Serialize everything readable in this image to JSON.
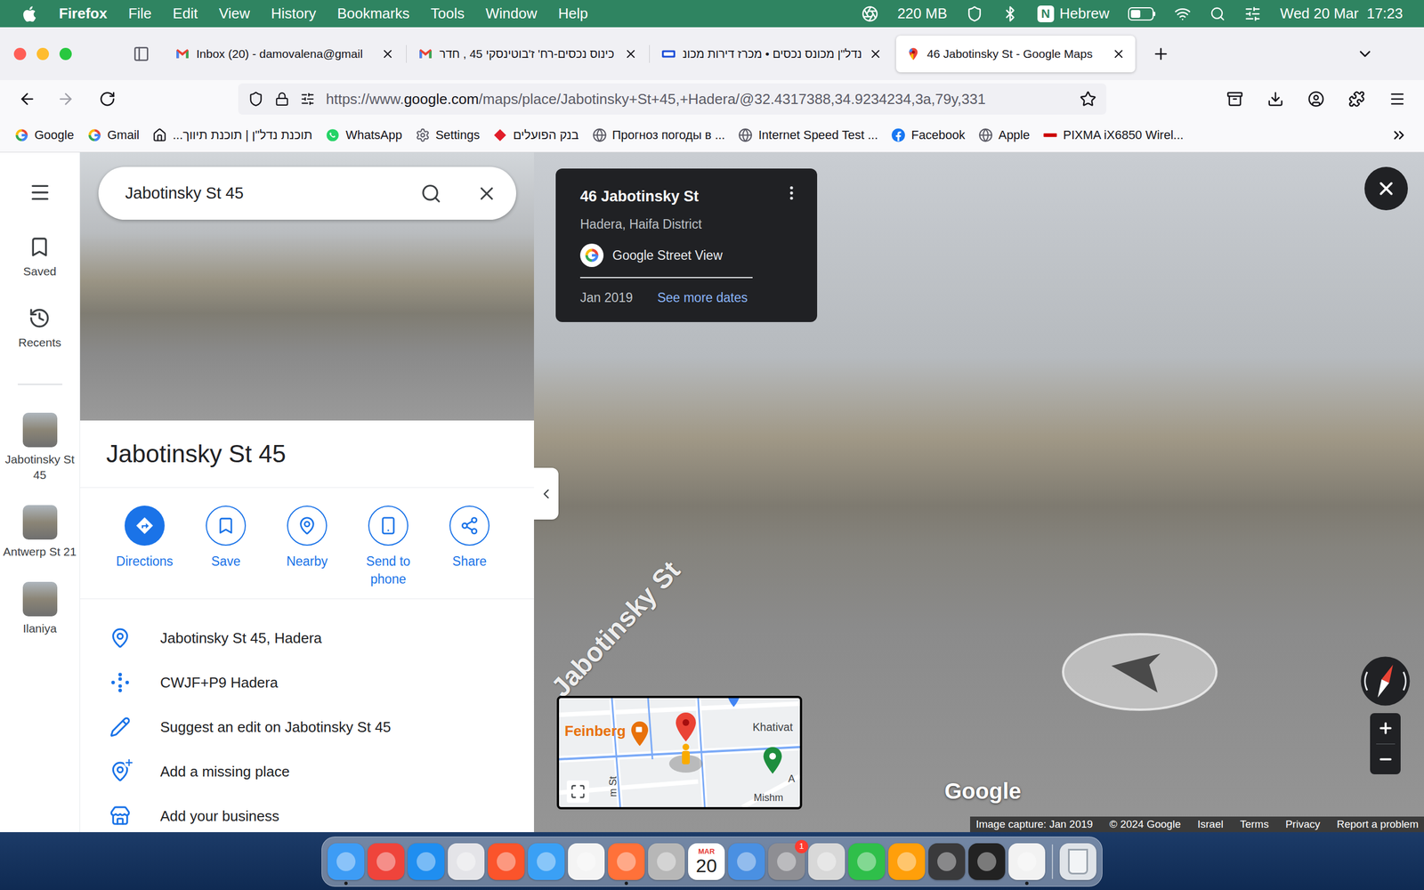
{
  "menu_bar": {
    "app": "Firefox",
    "menus": [
      "File",
      "Edit",
      "View",
      "History",
      "Bookmarks",
      "Tools",
      "Window",
      "Help"
    ],
    "memory": "220 MB",
    "input_source": "N",
    "input_label": "Hebrew",
    "battery": {
      "level": 0.45
    },
    "datetime": "Wed 20 Mar  17:23"
  },
  "tabs": [
    {
      "label": "Inbox (20) - damovalena@gmail",
      "kind": "gmail",
      "selected": false
    },
    {
      "label": "כינוס נכסים-רח' ז'בוטינסקי 45 , חדר",
      "kind": "gmail",
      "selected": false
    },
    {
      "label": "נדל\"ן מכונס נכסים • מכרז דירות מכונ",
      "kind": "site",
      "selected": false
    },
    {
      "label": "46 Jabotinsky St - Google Maps",
      "kind": "maps",
      "selected": true
    }
  ],
  "address_bar": {
    "prefix": "https://www.",
    "domain": "google.com",
    "path": "/maps/place/Jabotinsky+St+45,+Hadera/@32.4317388,34.9234234,3a,79y,331"
  },
  "bookmarks": [
    {
      "label": "Google",
      "kind": "google"
    },
    {
      "label": "Gmail",
      "kind": "google"
    },
    {
      "label": "תוכנת נדל\"ן | תוכנת תיווך...",
      "kind": "house"
    },
    {
      "label": "WhatsApp",
      "kind": "whatsapp"
    },
    {
      "label": "Settings",
      "kind": "gear"
    },
    {
      "label": "בנק הפועלים",
      "kind": "bank"
    },
    {
      "label": "Прогноз погоды в ...",
      "kind": "globe"
    },
    {
      "label": "Internet Speed Test ...",
      "kind": "globe"
    },
    {
      "label": "Facebook",
      "kind": "facebook"
    },
    {
      "label": "Apple",
      "kind": "globe"
    },
    {
      "label": "PIXMA iX6850 Wirel...",
      "kind": "canon"
    }
  ],
  "maps": {
    "search": {
      "value": "Jabotinsky St 45"
    },
    "rail": {
      "saved": "Saved",
      "recents": "Recents",
      "recent_items": [
        "Jabotinsky St 45",
        "Antwerp St 21",
        "Ilaniya"
      ]
    },
    "place": {
      "title": "Jabotinsky St 45",
      "actions": [
        {
          "label": "Directions",
          "kind": "primary"
        },
        {
          "label": "Save",
          "kind": "save"
        },
        {
          "label": "Nearby",
          "kind": "nearby"
        },
        {
          "label": "Send to phone",
          "kind": "phone"
        },
        {
          "label": "Share",
          "kind": "share"
        }
      ],
      "details": [
        {
          "label": "Jabotinsky St 45, Hadera",
          "kind": "address"
        },
        {
          "label": "CWJF+P9 Hadera",
          "kind": "plus_code"
        },
        {
          "label": "Suggest an edit on Jabotinsky St 45",
          "kind": "edit"
        },
        {
          "label": "Add a missing place",
          "kind": "add_place"
        },
        {
          "label": "Add your business",
          "kind": "business"
        }
      ]
    },
    "street_view": {
      "card": {
        "title": "46 Jabotinsky St",
        "subtitle": "Hadera, Haifa District",
        "source": "Google Street View",
        "date": "Jan 2019",
        "more_dates": "See more dates"
      },
      "street_label": "Jabotinsky St",
      "minimap": {
        "labels": [
          {
            "label": "Feinberg",
            "kind": "place"
          },
          {
            "label": "Khativat",
            "kind": "street"
          },
          {
            "label": "m St",
            "kind": "street_vertical"
          },
          {
            "label": "Mishm",
            "kind": "street"
          },
          {
            "label": "A",
            "kind": "street"
          }
        ]
      },
      "logo": "Google",
      "footer": [
        "Image capture: Jan 2019",
        "© 2024 Google",
        "Israel",
        "Terms",
        "Privacy",
        "Report a problem"
      ]
    }
  },
  "dock": [
    {
      "kind": "app",
      "color": "#3d9cf5",
      "running": true
    },
    {
      "kind": "app",
      "color": "#ef443b",
      "running": false
    },
    {
      "kind": "app",
      "color": "#1f8ef0",
      "running": false
    },
    {
      "kind": "app",
      "color": "#e4e4e8",
      "running": false
    },
    {
      "kind": "app",
      "color": "#fb542b",
      "running": false
    },
    {
      "kind": "app",
      "color": "#3aa0f5",
      "running": false
    },
    {
      "kind": "app",
      "color": "#f4f4f4",
      "running": false
    },
    {
      "kind": "app",
      "color": "#ff7139",
      "running": true
    },
    {
      "kind": "app",
      "color": "#b7b7b7",
      "running": false
    },
    {
      "kind": "calendar",
      "color": "#ffffff",
      "month": "MAR",
      "day": "20",
      "running": false
    },
    {
      "kind": "app",
      "color": "#4a90e2",
      "running": false
    },
    {
      "kind": "app",
      "color": "#8e8e93",
      "badge": "1",
      "running": false
    },
    {
      "kind": "app",
      "color": "#d8d8d8",
      "running": false
    },
    {
      "kind": "app",
      "color": "#2fbf4a",
      "running": false
    },
    {
      "kind": "app",
      "color": "#ff9f0a",
      "running": false
    },
    {
      "kind": "app",
      "color": "#3a3a3c",
      "running": false
    },
    {
      "kind": "app",
      "color": "#222222",
      "running": false
    },
    {
      "kind": "app",
      "color": "#f2f2f2",
      "running": true
    },
    {
      "kind": "separator"
    },
    {
      "kind": "trash",
      "color": "#dfe3e8",
      "running": false
    }
  ]
}
